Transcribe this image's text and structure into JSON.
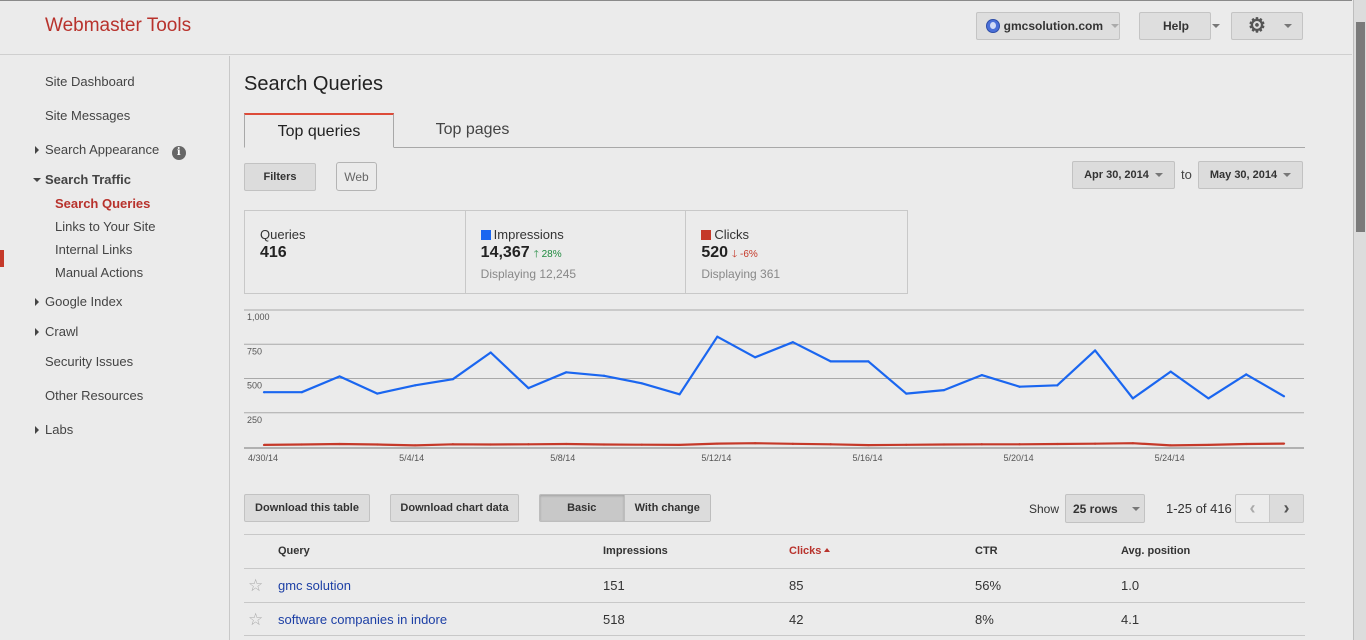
{
  "header": {
    "brand": "Webmaster Tools",
    "site_selector": {
      "icon": "globe-icon",
      "label": "gmcsolution.com"
    },
    "help_label": "Help",
    "settings_icon": "gear-icon"
  },
  "sidebar": {
    "items": [
      {
        "label": "Site Dashboard",
        "expandable": false
      },
      {
        "label": "Site Messages",
        "expandable": false
      },
      {
        "label": "Search Appearance",
        "expandable": true,
        "info_icon": "info-icon"
      },
      {
        "label": "Search Traffic",
        "expandable": true,
        "expanded": true,
        "children": [
          {
            "label": "Search Queries",
            "active": true
          },
          {
            "label": "Links to Your Site"
          },
          {
            "label": "Internal Links"
          },
          {
            "label": "Manual Actions"
          }
        ]
      },
      {
        "label": "Google Index",
        "expandable": true
      },
      {
        "label": "Crawl",
        "expandable": true
      },
      {
        "label": "Security Issues",
        "expandable": false
      },
      {
        "label": "Other Resources",
        "expandable": false
      },
      {
        "label": "Labs",
        "expandable": true
      }
    ]
  },
  "main": {
    "title": "Search Queries",
    "tabs": [
      {
        "label": "Top queries",
        "active": true
      },
      {
        "label": "Top pages",
        "active": false
      }
    ],
    "filters_label": "Filters",
    "filter_chip": "Web",
    "date_from": "Apr 30, 2014",
    "date_to_label": "to",
    "date_to": "May 30, 2014",
    "stats": {
      "queries": {
        "label": "Queries",
        "value": "416"
      },
      "impressions": {
        "label": "Impressions",
        "value": "14,367",
        "delta": "28%",
        "delta_dir": "up",
        "sub": "Displaying 12,245",
        "color": "#1a66f0"
      },
      "clicks": {
        "label": "Clicks",
        "value": "520",
        "delta": "-6%",
        "delta_dir": "down",
        "sub": "Displaying 361",
        "color": "#c53929"
      }
    }
  },
  "chart_data": {
    "type": "line",
    "title": "",
    "xlabel": "",
    "ylabel": "",
    "ylim": [
      0,
      1000
    ],
    "yticks": [
      250,
      500,
      750,
      1000
    ],
    "ytick_labels": [
      "250",
      "500",
      "750",
      "1,000"
    ],
    "grid": true,
    "x": [
      "4/30/14",
      "5/1/14",
      "5/2/14",
      "5/3/14",
      "5/4/14",
      "5/5/14",
      "5/6/14",
      "5/7/14",
      "5/8/14",
      "5/9/14",
      "5/10/14",
      "5/11/14",
      "5/12/14",
      "5/13/14",
      "5/14/14",
      "5/15/14",
      "5/16/14",
      "5/17/14",
      "5/18/14",
      "5/19/14",
      "5/20/14",
      "5/21/14",
      "5/22/14",
      "5/23/14",
      "5/24/14",
      "5/25/14",
      "5/26/14",
      "5/27/14"
    ],
    "xtick_labels": [
      "4/30/14",
      "5/4/14",
      "5/8/14",
      "5/12/14",
      "5/16/14",
      "5/20/14",
      "5/24/14"
    ],
    "series": [
      {
        "name": "Impressions",
        "color": "#1a66f0",
        "values": [
          400,
          400,
          515,
          390,
          450,
          495,
          690,
          430,
          545,
          520,
          465,
          385,
          805,
          655,
          765,
          625,
          625,
          390,
          415,
          525,
          440,
          450,
          705,
          355,
          550,
          355,
          530,
          370
        ]
      },
      {
        "name": "Clicks",
        "color": "#c53929",
        "values": [
          15,
          18,
          22,
          18,
          12,
          20,
          18,
          20,
          22,
          18,
          17,
          15,
          25,
          28,
          23,
          20,
          14,
          16,
          18,
          20,
          20,
          22,
          24,
          28,
          12,
          15,
          22,
          25
        ]
      }
    ]
  },
  "table_controls": {
    "download_table": "Download this table",
    "download_chart": "Download chart data",
    "view_basic": "Basic",
    "view_change": "With change",
    "show_label": "Show",
    "rows_option": "25 rows",
    "range": "1-25 of 416",
    "prev_icon": "chevron-left-icon",
    "next_icon": "chevron-right-icon"
  },
  "table": {
    "columns": [
      "Query",
      "Impressions",
      "Clicks",
      "CTR",
      "Avg. position"
    ],
    "sorted_column": "Clicks",
    "rows": [
      {
        "query": "gmc solution",
        "impressions": "151",
        "clicks": "85",
        "ctr": "56%",
        "position": "1.0"
      },
      {
        "query": "software companies in indore",
        "impressions": "518",
        "clicks": "42",
        "ctr": "8%",
        "position": "4.1"
      }
    ]
  }
}
